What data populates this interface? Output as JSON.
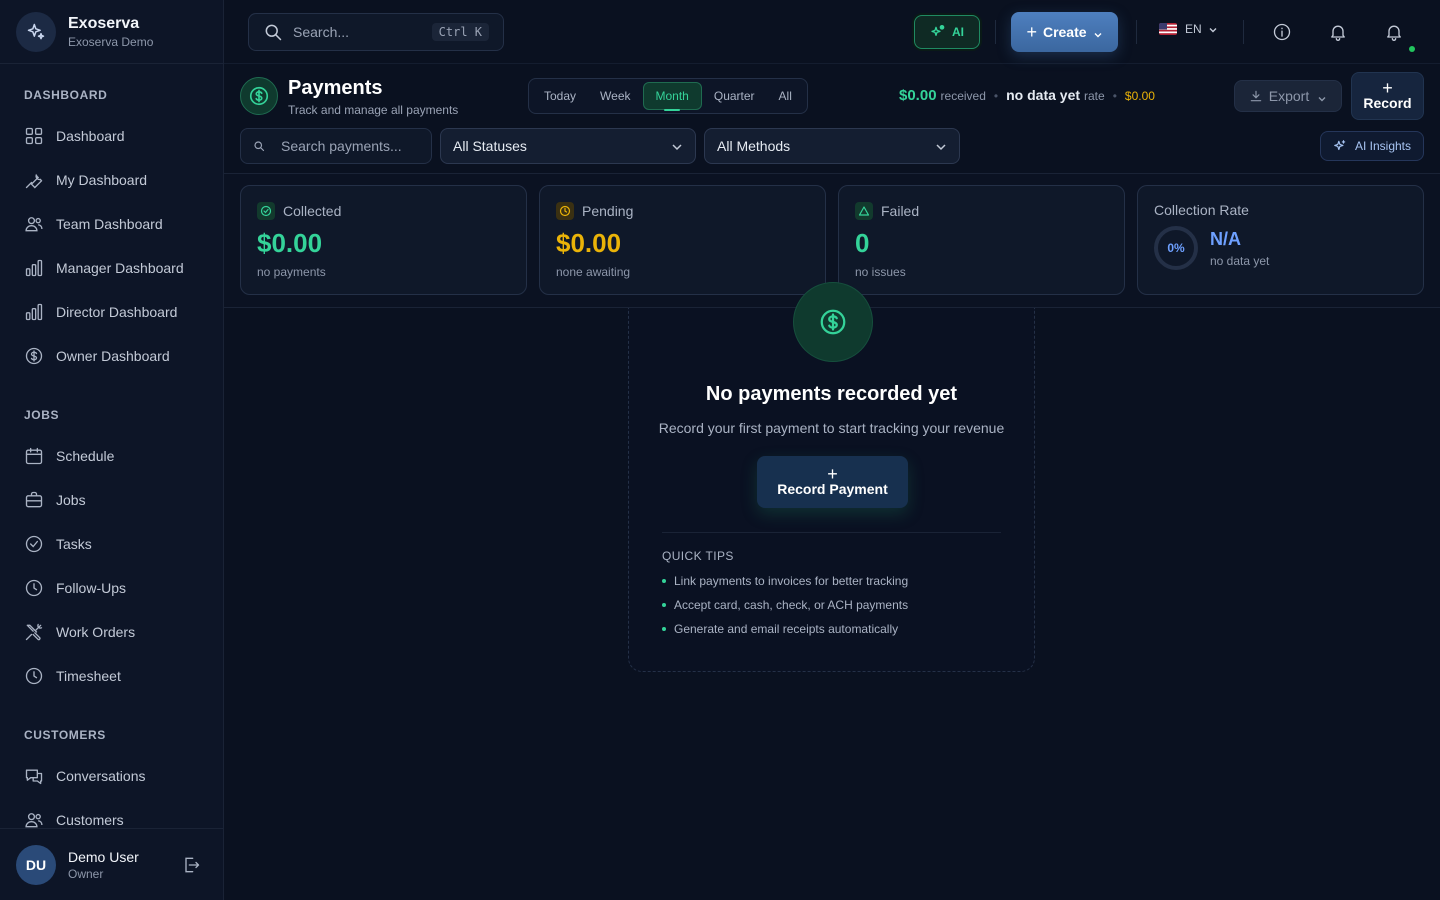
{
  "brand": {
    "name": "Exoserva",
    "subtitle": "Exoserva Demo"
  },
  "sidebar": {
    "sections": [
      {
        "title": "DASHBOARD",
        "items": [
          {
            "label": "Dashboard",
            "icon": "grid-icon"
          },
          {
            "label": "My Dashboard",
            "icon": "wrench-icon"
          },
          {
            "label": "Team Dashboard",
            "icon": "users-icon"
          },
          {
            "label": "Manager Dashboard",
            "icon": "bar-chart-icon"
          },
          {
            "label": "Director Dashboard",
            "icon": "bar-chart-icon"
          },
          {
            "label": "Owner Dashboard",
            "icon": "dollar-circle-icon"
          }
        ]
      },
      {
        "title": "JOBS",
        "items": [
          {
            "label": "Schedule",
            "icon": "calendar-icon"
          },
          {
            "label": "Jobs",
            "icon": "briefcase-icon"
          },
          {
            "label": "Tasks",
            "icon": "check-circle-icon"
          },
          {
            "label": "Follow-Ups",
            "icon": "clock-icon"
          },
          {
            "label": "Work Orders",
            "icon": "tools-icon"
          },
          {
            "label": "Timesheet",
            "icon": "clock-icon"
          }
        ]
      },
      {
        "title": "CUSTOMERS",
        "items": [
          {
            "label": "Conversations",
            "icon": "chat-icon"
          },
          {
            "label": "Customers",
            "icon": "users-icon"
          }
        ]
      }
    ]
  },
  "user": {
    "initials": "DU",
    "name": "Demo User",
    "role": "Owner"
  },
  "topbar": {
    "search_placeholder": "Search...",
    "shortcut": "Ctrl K",
    "ai_label": "AI",
    "create_label": "Create",
    "language": "EN"
  },
  "page": {
    "title": "Payments",
    "subtitle": "Track and manage all payments",
    "periods": [
      "Today",
      "Week",
      "Month",
      "Quarter",
      "All"
    ],
    "active_period": "Month",
    "summary": {
      "received_value": "$0.00",
      "received_label": "received",
      "rate_value": "no data yet",
      "rate_label": "rate",
      "pending_value": "$0.00"
    },
    "export_label": "Export",
    "record_label": "Record",
    "search_payments_placeholder": "Search payments...",
    "status_filter": "All Statuses",
    "method_filter": "All Methods",
    "ai_insights_label": "AI Insights"
  },
  "kpis": {
    "collected": {
      "label": "Collected",
      "value": "$0.00",
      "note": "no payments"
    },
    "pending": {
      "label": "Pending",
      "value": "$0.00",
      "note": "none awaiting"
    },
    "failed": {
      "label": "Failed",
      "value": "0",
      "note": "no issues"
    },
    "rate": {
      "label": "Collection Rate",
      "ring": "0%",
      "value": "N/A",
      "note": "no data yet"
    }
  },
  "empty_state": {
    "title": "No payments recorded yet",
    "subtitle": "Record your first payment to start tracking your revenue",
    "button": "Record Payment",
    "tips_title": "QUICK TIPS",
    "tips": [
      "Link payments to invoices for better tracking",
      "Accept card, cash, check, or ACH payments",
      "Generate and email receipts automatically"
    ]
  },
  "colors": {
    "accent_green": "#34d399",
    "accent_blue": "#4e7fbf",
    "pending_yellow": "#eab308",
    "rate_blue": "#6ea0ff",
    "background": "#0a1120"
  }
}
